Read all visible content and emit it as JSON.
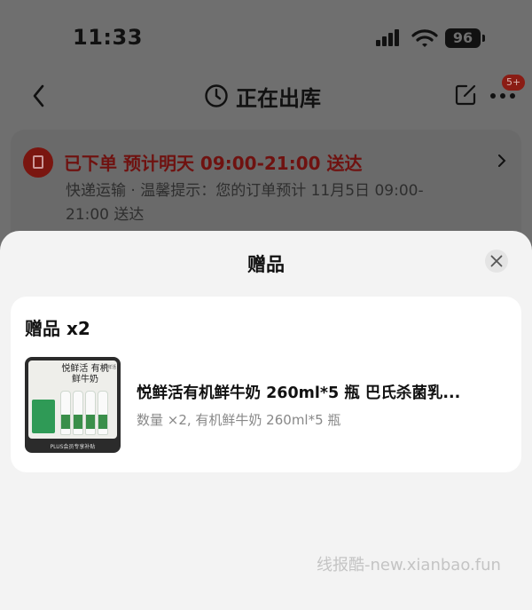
{
  "status_bar": {
    "time": "11:33",
    "battery": "96",
    "icons": [
      "signal-icon",
      "wifi-icon",
      "battery-icon"
    ]
  },
  "nav": {
    "title": "正在出库",
    "badge": "5+",
    "icons": [
      "back-icon",
      "clock-icon",
      "edit-icon",
      "more-icon"
    ]
  },
  "order": {
    "status": "已下单 预计明天 09:00-21:00 送达",
    "description": "快递运输 · 温馨提示：您的订单预计 11月5日 09:00-21:00 送达"
  },
  "sheet": {
    "title": "赠品",
    "gift_heading": "赠品 x2",
    "product": {
      "name": "悦鲜活有机鲜牛奶 260ml*5 瓶 巴氏杀菌乳...",
      "meta": "数量 ×2, 有机鲜牛奶 260ml*5 瓶",
      "thumb_title": "悦鲜活 有机鲜牛奶",
      "thumb_brand": "悦鲜活",
      "thumb_footer": "PLUS会员专享补贴"
    }
  },
  "watermark": "线报酷-new.xianbao.fun",
  "colors": {
    "overlay": "#6f6f6f",
    "sheet_bg": "#f3f3f3",
    "card_bg": "#ffffff",
    "accent_red": "#6f1210",
    "meta_gray": "#888888"
  }
}
